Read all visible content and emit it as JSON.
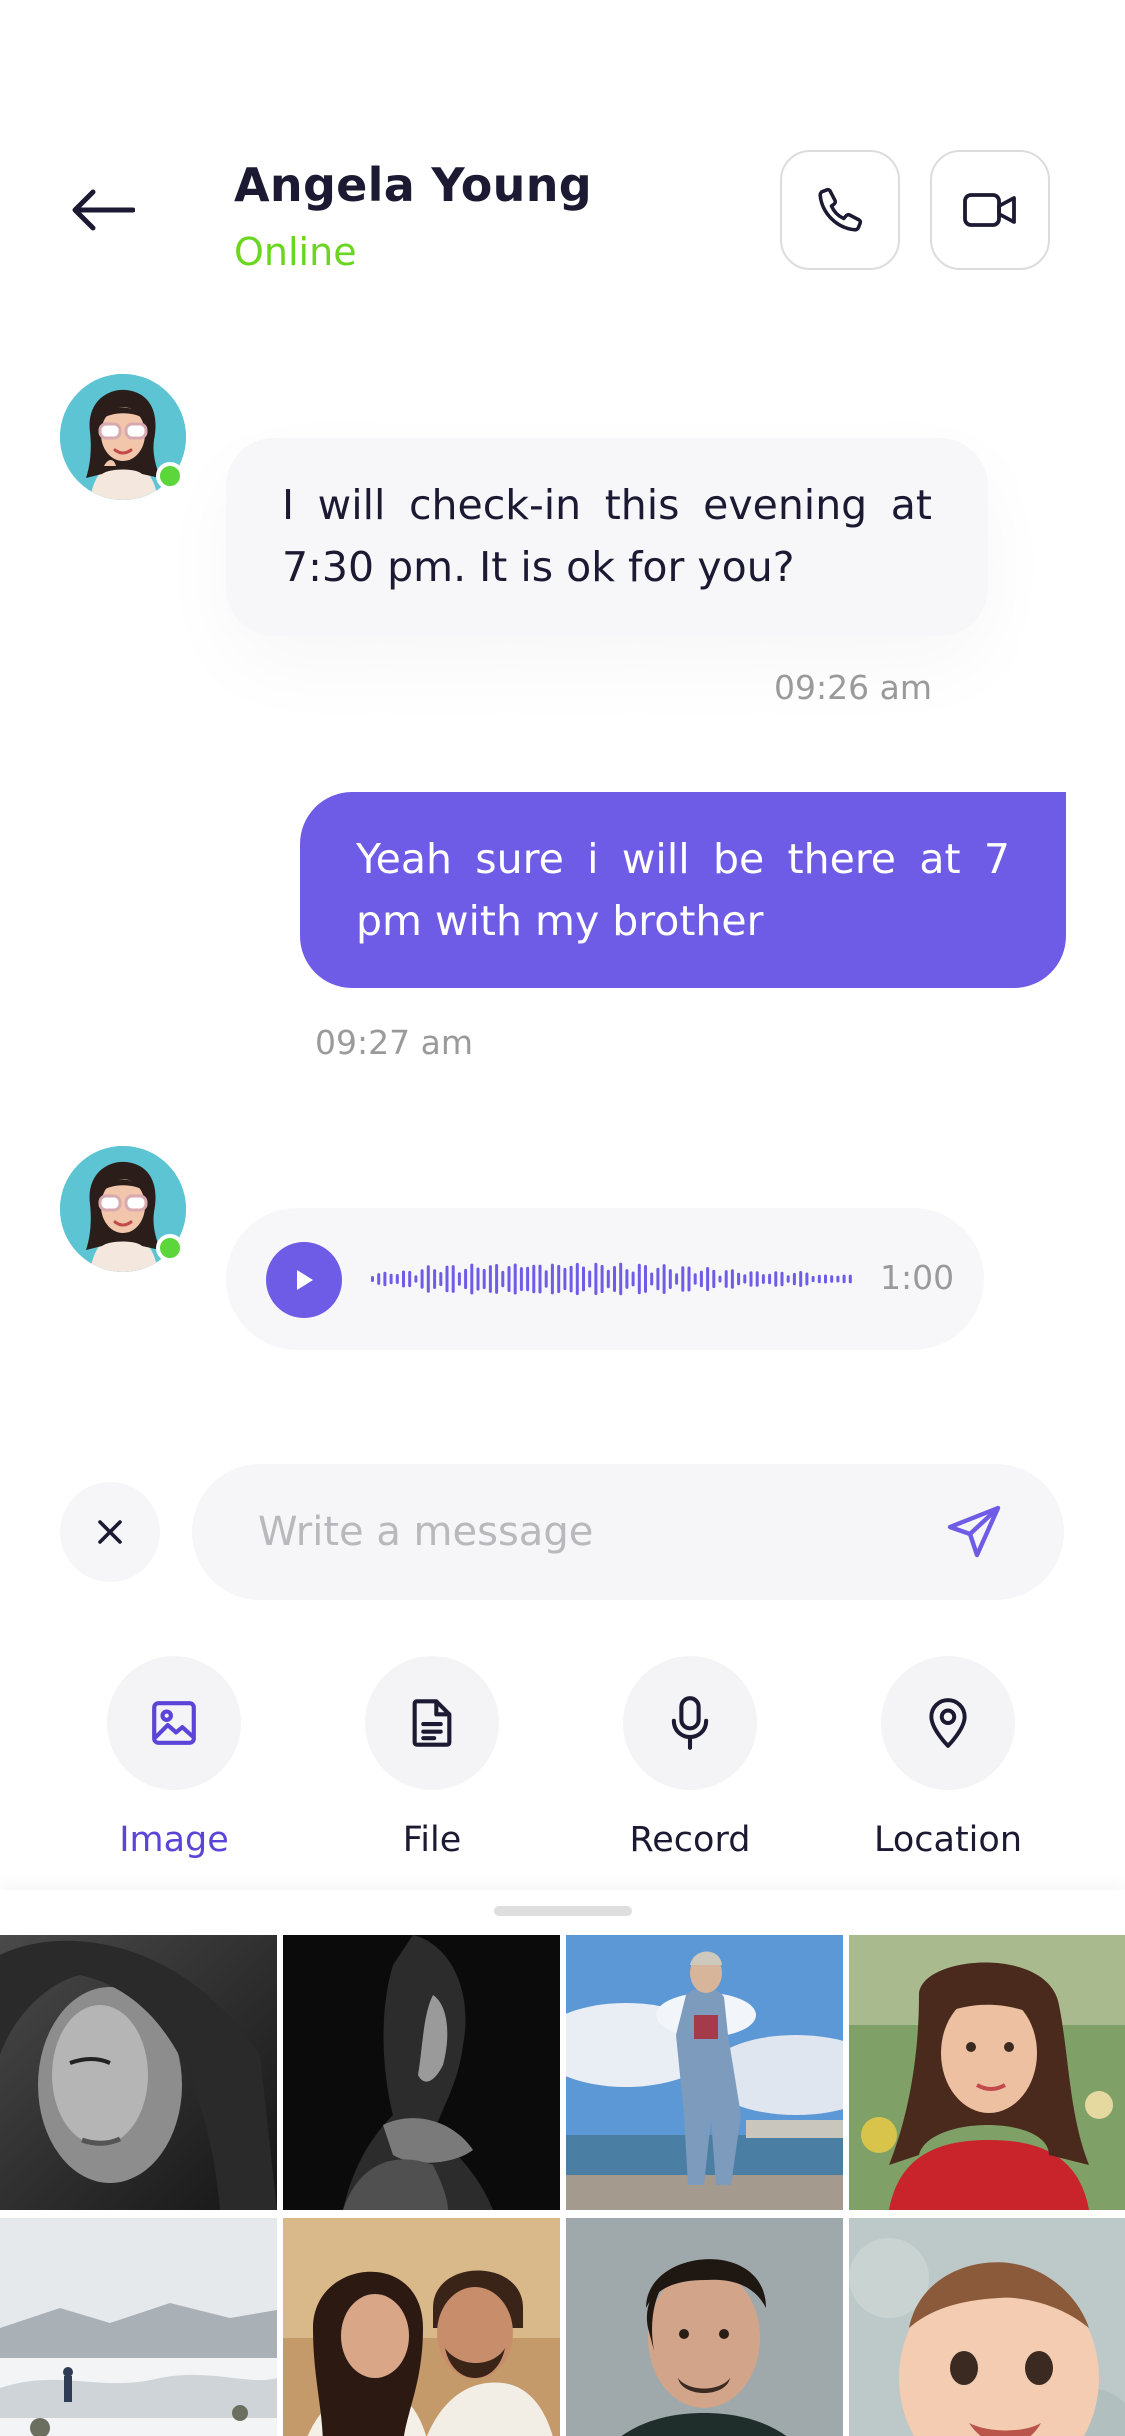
{
  "header": {
    "name": "Angela Young",
    "status": "Online",
    "status_color": "#6ad620",
    "icons": {
      "back": "arrow-left-icon",
      "call": "phone-icon",
      "video": "video-camera-icon"
    }
  },
  "messages": [
    {
      "from": "contact",
      "text": "I will check-in this evening at 7:30 pm. It is ok for you?",
      "time": "09:26 am"
    },
    {
      "from": "me",
      "text": "Yeah sure i will be there at 7 pm with my brother",
      "time": "09:27 am"
    },
    {
      "from": "contact",
      "type": "voice",
      "duration": "1:00"
    }
  ],
  "composer": {
    "placeholder": "Write a message",
    "value": "",
    "icons": {
      "close": "close-icon",
      "send": "send-icon"
    }
  },
  "attachments": [
    {
      "label": "Image",
      "icon": "image-icon",
      "active": true
    },
    {
      "label": "File",
      "icon": "file-icon",
      "active": false
    },
    {
      "label": "Record",
      "icon": "microphone-icon",
      "active": false
    },
    {
      "label": "Location",
      "icon": "location-pin-icon",
      "active": false
    }
  ],
  "gallery": {
    "photos": [
      "portrait-woman-bw",
      "woman-silhouette-bw",
      "man-denim-sky",
      "woman-red-dress",
      "snowy-landscape",
      "couple-embrace",
      "man-portrait",
      "baby-portrait"
    ]
  },
  "colors": {
    "accent": "#6e5ce7",
    "online": "#5bd63b",
    "active_label": "#5b45d8",
    "text": "#1c1a33",
    "muted": "#9a9a9a"
  }
}
